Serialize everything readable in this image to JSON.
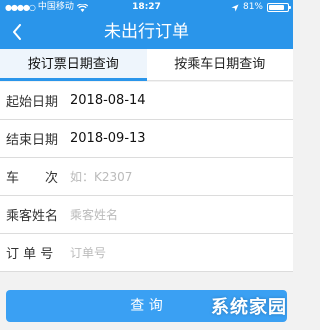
{
  "status_bar": {
    "carrier": "中国移动",
    "time": "18:27",
    "battery": "81%",
    "battery_level": 0.81
  },
  "nav": {
    "back_icon": "chevron-left-icon",
    "title": "未出行订单"
  },
  "tabs": [
    {
      "label": "按订票日期查询",
      "active": true
    },
    {
      "label": "按乘车日期查询",
      "active": false
    }
  ],
  "form": {
    "start_date": {
      "label": "起始日期",
      "value": "2018-08-14"
    },
    "end_date": {
      "label": "结束日期",
      "value": "2018-09-13"
    },
    "train_no": {
      "label": "车　　次",
      "placeholder": "如：K2307"
    },
    "passenger": {
      "label": "乘客姓名",
      "placeholder": "乘客姓名"
    },
    "order_no": {
      "label": "订 单 号",
      "placeholder": "订单号"
    }
  },
  "query_button": {
    "label": "查 询"
  },
  "watermark": "系统家园",
  "colors": {
    "primary": "#2a95ea",
    "button": "#3aa0f3"
  }
}
